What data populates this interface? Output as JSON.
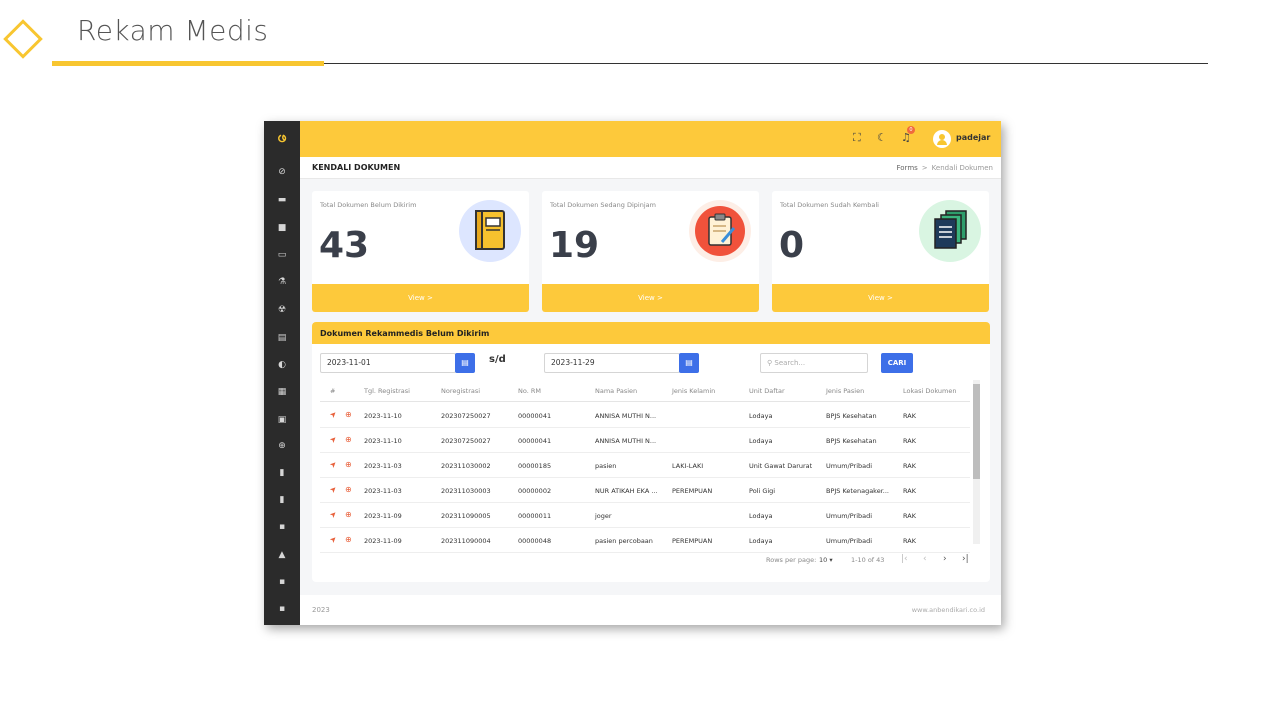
{
  "slide": {
    "title": "Rekam Medis"
  },
  "topbar": {
    "username": "padejar",
    "notif_count": "0"
  },
  "page": {
    "heading": "KENDALI DOKUMEN",
    "breadcrumb": [
      "Forms",
      "Kendali Dokumen"
    ]
  },
  "cards": [
    {
      "label": "Total Dokumen Belum Dikirim",
      "count": "43",
      "link": "View >",
      "icon": "book-icon",
      "icon_bg": "#dde6ff"
    },
    {
      "label": "Total Dokumen Sedang Dipinjam",
      "count": "19",
      "link": "View >",
      "icon": "clipboard-icon",
      "icon_bg": "#fdeee6"
    },
    {
      "label": "Total Dokumen Sudah Kembali",
      "count": "0",
      "link": "View >",
      "icon": "documents-icon",
      "icon_bg": "#d9f5e2"
    }
  ],
  "panel": {
    "title": "Dokumen Rekammedis Belum Dikirim",
    "date_from": "2023-11-01",
    "separator": "s/d",
    "date_to": "2023-11-29",
    "search_placeholder": "Search...",
    "search_button": "CARI"
  },
  "table": {
    "columns": [
      "#",
      "Tgl. Registrasi",
      "Noregistrasi",
      "No. RM",
      "Nama Pasien",
      "Jenis Kelamin",
      "Unit Daftar",
      "Jenis Pasien",
      "Lokasi Dokumen"
    ],
    "rows": [
      [
        "2023-11-10",
        "202307250027",
        "00000041",
        "ANNISA MUTHI N...",
        "",
        "Lodaya",
        "BPJS Kesehatan",
        "RAK"
      ],
      [
        "2023-11-10",
        "202307250027",
        "00000041",
        "ANNISA MUTHI N...",
        "",
        "Lodaya",
        "BPJS Kesehatan",
        "RAK"
      ],
      [
        "2023-11-03",
        "202311030002",
        "00000185",
        "pasien",
        "LAKI-LAKI",
        "Unit Gawat Darurat",
        "Umum/Pribadi",
        "RAK"
      ],
      [
        "2023-11-03",
        "202311030003",
        "00000002",
        "NUR ATIKAH EKA ...",
        "PEREMPUAN",
        "Poli Gigi",
        "BPJS Ketenagaker...",
        "RAK"
      ],
      [
        "2023-11-09",
        "202311090005",
        "00000011",
        "joger",
        "",
        "Lodaya",
        "Umum/Pribadi",
        "RAK"
      ],
      [
        "2023-11-09",
        "202311090004",
        "00000048",
        "pasien percobaan",
        "PEREMPUAN",
        "Lodaya",
        "Umum/Pribadi",
        "RAK"
      ]
    ]
  },
  "pagination": {
    "rows_label": "Rows per page:",
    "rows_value": "10",
    "range": "1-10 of 43"
  },
  "footer": {
    "year": "2023",
    "site": "www.anbendikari.co.id"
  },
  "colors": {
    "accent": "#fdc93b",
    "sidebar": "#2b2b2b",
    "button": "#3d6fe8",
    "action": "#e8613c"
  }
}
